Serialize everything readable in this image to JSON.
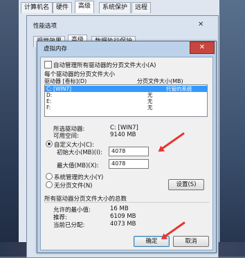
{
  "system_properties": {
    "tabs": [
      "计算机名",
      "硬件",
      "高级",
      "系统保护",
      "远程"
    ],
    "active_tab": "高级"
  },
  "performance_options": {
    "title": "性能选项",
    "close_glyph": "✕",
    "tabs": [
      "视觉效果",
      "高级",
      "数据执行保护"
    ],
    "active_tab": "高级"
  },
  "virtual_memory": {
    "title": "虚拟内存",
    "close_glyph": "✕",
    "auto_manage_label": "自动管理所有驱动器的分页文件大小(A)",
    "auto_manage_checked": false,
    "section_label": "每个驱动器的分页文件大小",
    "col_drive": "驱动器 [卷标](D)",
    "col_paging": "分页文件大小(MB)",
    "drives": [
      {
        "drive": "C:   [WIN7]",
        "size": "托管的系统",
        "selected": true
      },
      {
        "drive": "D:",
        "size": "无",
        "selected": false
      },
      {
        "drive": "E:",
        "size": "无",
        "selected": false
      },
      {
        "drive": "F:",
        "size": "无",
        "selected": false
      }
    ],
    "selected_drive_label": "所选驱动器:",
    "selected_drive_value": "C:  [WIN7]",
    "free_space_label": "可用空间:",
    "free_space_value": "9140 MB",
    "custom_size_label": "自定义大小(C):",
    "initial_size_label": "初始大小(MB)(I):",
    "initial_size_value": "4078",
    "max_size_label": "最大值(MB)(X):",
    "max_size_value": "4078",
    "system_managed_label": "系统管理的大小(Y)",
    "no_paging_label": "无分页文件(N)",
    "set_button": "设置(S)",
    "total_section_label": "所有驱动器分页文件大小的总数",
    "min_allowed_label": "允许的最小值:",
    "min_allowed_value": "16 MB",
    "recommended_label": "推荐:",
    "recommended_value": "6109 MB",
    "current_label": "当前已分配:",
    "current_value": "4073 MB",
    "ok_button": "确定",
    "cancel_button": "取消"
  }
}
